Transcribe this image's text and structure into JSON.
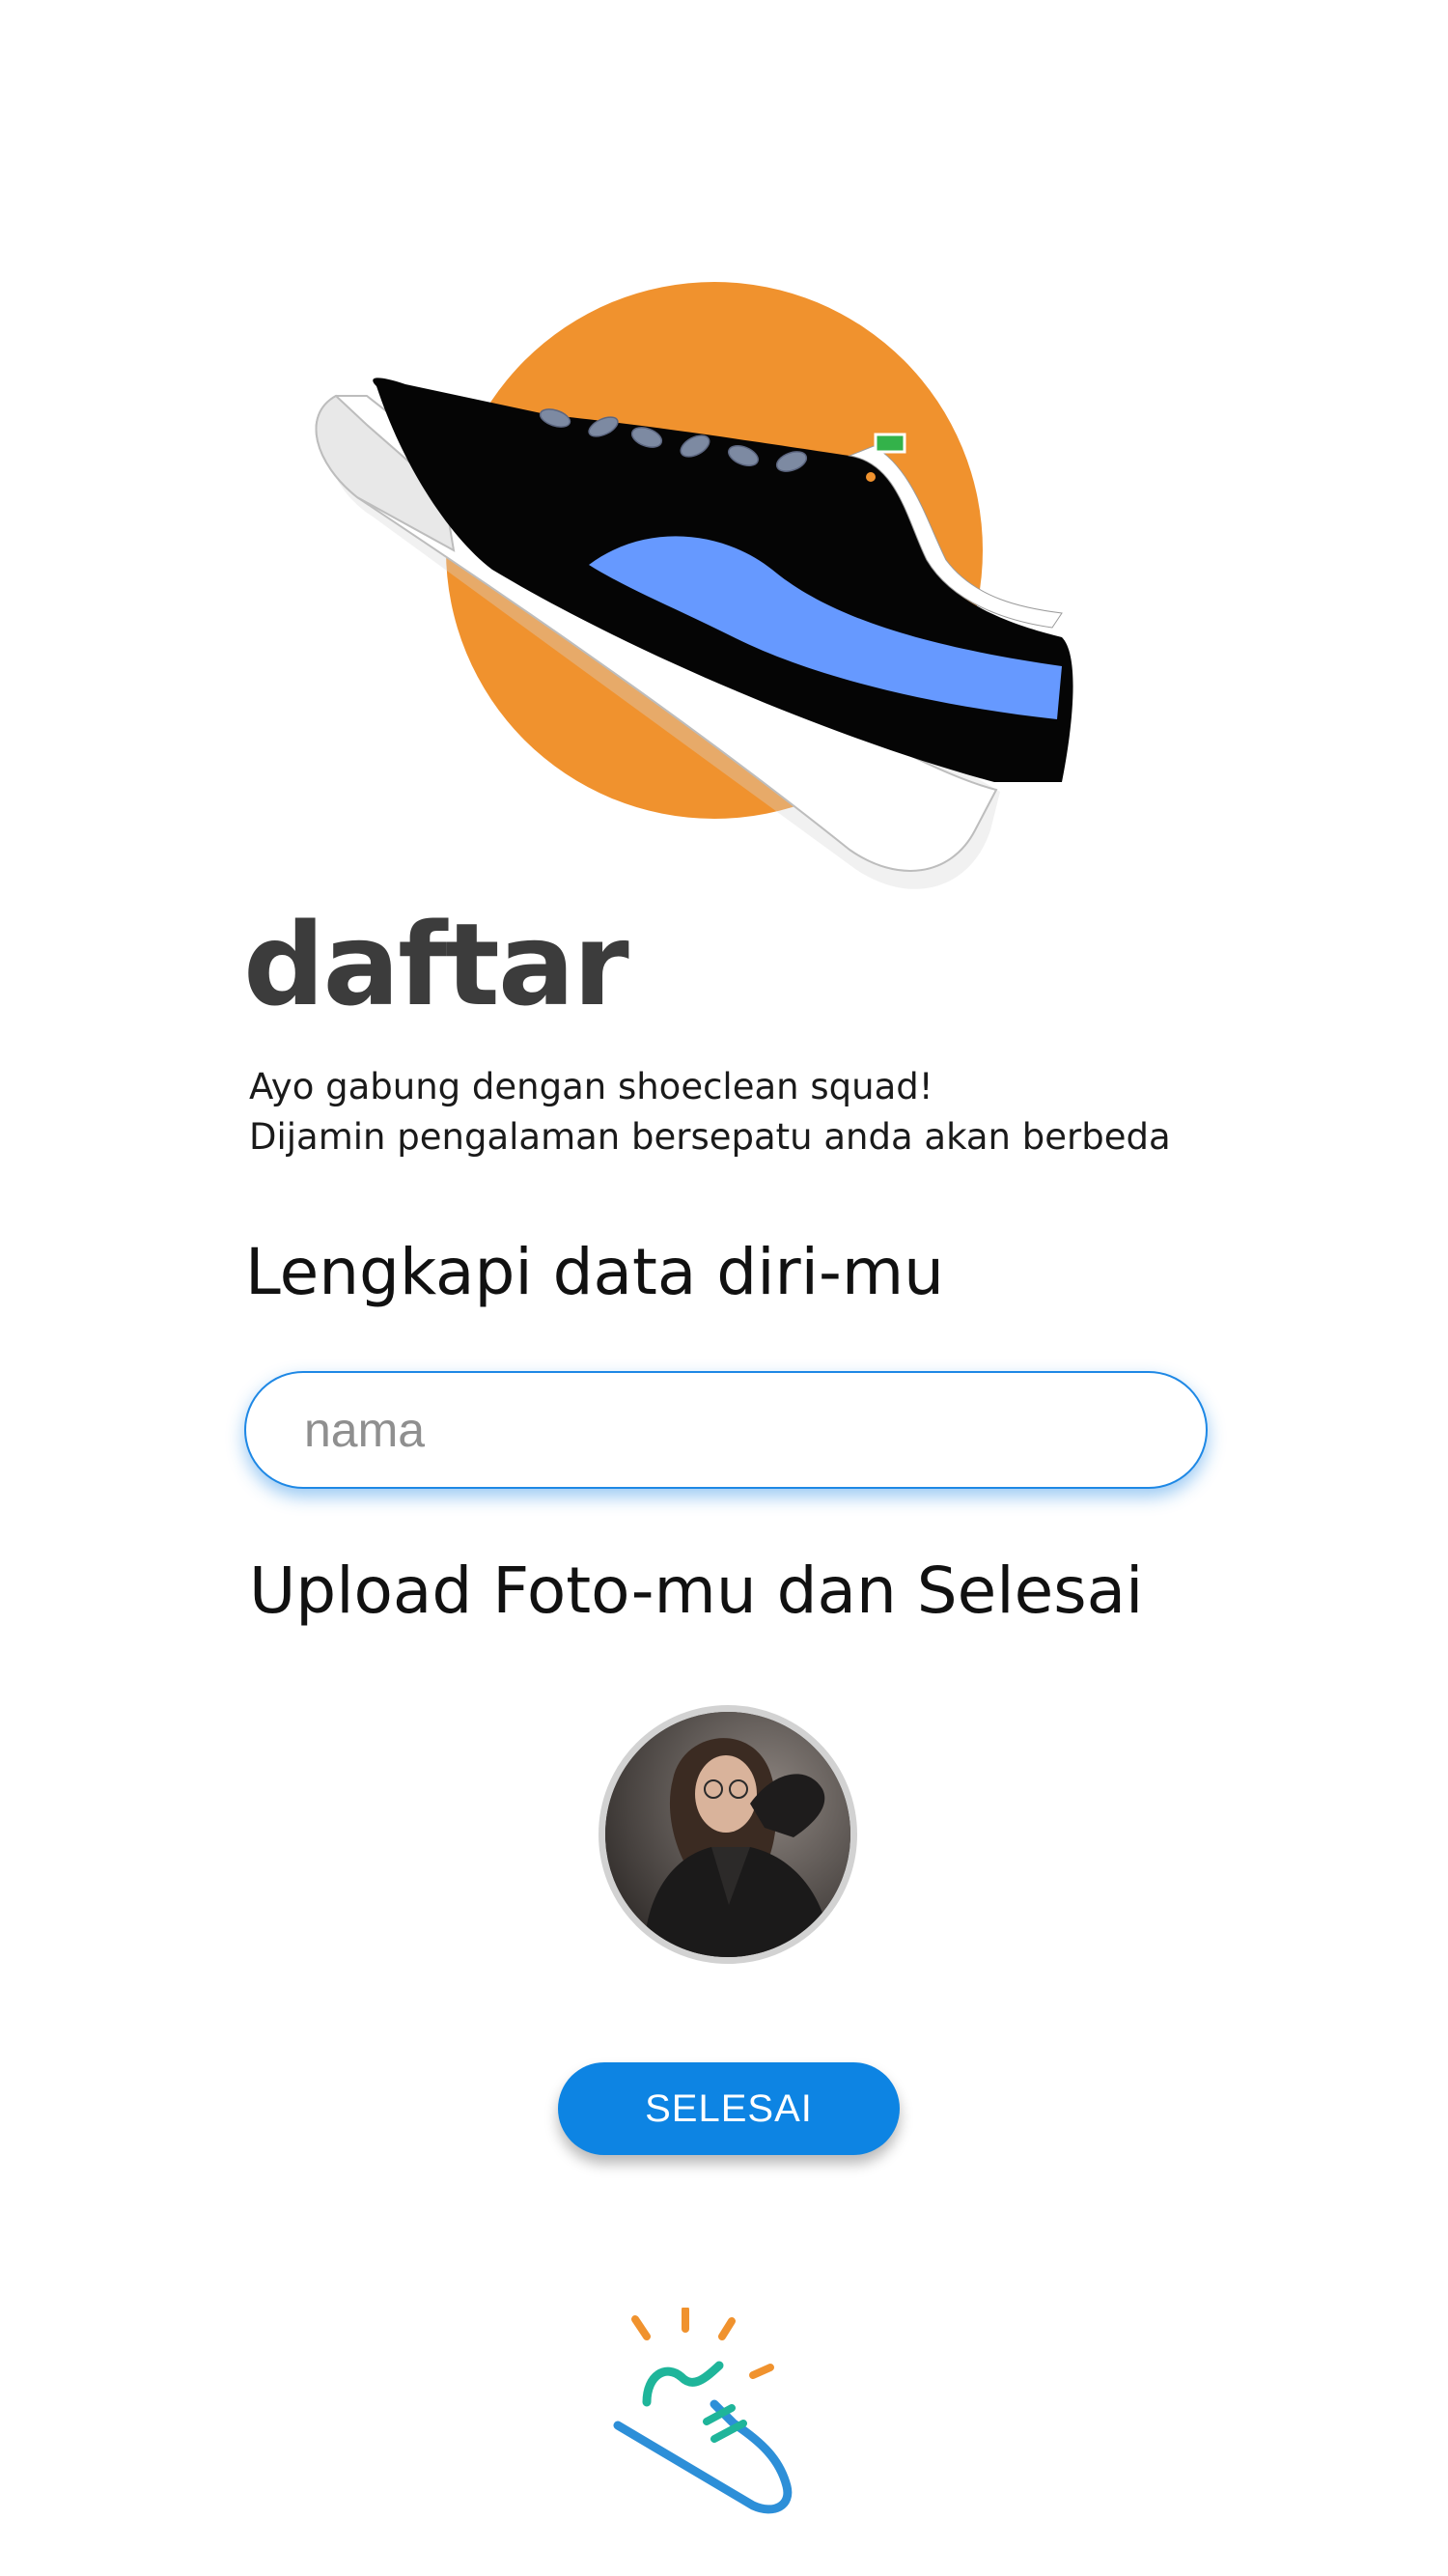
{
  "header": {
    "title": "daftar",
    "subtitle_line1": "Ayo gabung dengan shoeclean squad!",
    "subtitle_line2": "Dijamin pengalaman bersepatu anda akan berbeda"
  },
  "form": {
    "section_data_label": "Lengkapi data diri-mu",
    "name_placeholder": "nama",
    "name_value": "",
    "section_upload_label": "Upload Foto-mu dan Selesai",
    "finish_label": "SELESAI"
  },
  "icons": {
    "hero": "sneaker-illustration",
    "avatar": "profile-photo",
    "logo": "shoeclean-logo"
  },
  "colors": {
    "accent": "#0d84e3",
    "orange": "#f0922e",
    "stripe": "#6699ff",
    "heading": "#3c3c3c",
    "logo_teal": "#1fb59a",
    "logo_blue": "#2d8fd8"
  }
}
